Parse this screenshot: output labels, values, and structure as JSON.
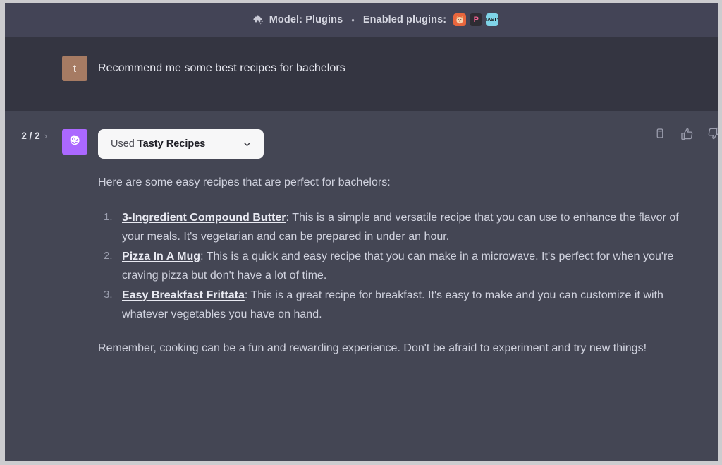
{
  "topbar": {
    "plugins_icon": "puzzle-piece-icon",
    "model_label": "Model: Plugins",
    "separator": "•",
    "enabled_label": "Enabled plugins:",
    "plugins": [
      {
        "name": "speak-plugin-badge",
        "short": ""
      },
      {
        "name": "prompt-perfect-plugin-badge",
        "short": "P"
      },
      {
        "name": "tasty-recipes-plugin-badge",
        "short": "TASTY"
      }
    ]
  },
  "user_message": {
    "avatar_initial": "t",
    "text": "Recommend me some best recipes for bachelors"
  },
  "assistant_message": {
    "pager": {
      "count": "2 / 2",
      "next_chevron": "›"
    },
    "avatar_icon": "openai-logo-icon",
    "plugin_pill": {
      "prefix": "Used",
      "plugin_name": "Tasty Recipes",
      "chevron_icon": "chevron-down-icon"
    },
    "intro": "Here are some easy recipes that are perfect for bachelors:",
    "recipes": [
      {
        "title": "3-Ingredient Compound Butter",
        "description": ": This is a simple and versatile recipe that you can use to enhance the flavor of your meals. It's vegetarian and can be prepared in under an hour."
      },
      {
        "title": "Pizza In A Mug",
        "description": ": This is a quick and easy recipe that you can make in a microwave. It's perfect for when you're craving pizza but don't have a lot of time."
      },
      {
        "title": "Easy Breakfast Frittata",
        "description": ": This is a great recipe for breakfast. It's easy to make and you can customize it with whatever vegetables you have on hand."
      }
    ],
    "outro": "Remember, cooking can be a fun and rewarding experience. Don't be afraid to experiment and try new things!",
    "actions": [
      {
        "name": "copy-icon"
      },
      {
        "name": "thumbs-up-icon"
      },
      {
        "name": "thumbs-down-icon"
      }
    ]
  },
  "colors": {
    "page_background": "#343541",
    "assistant_background": "#444654",
    "topbar_background": "#434456",
    "user_avatar": "#a67b63",
    "assistant_avatar": "#ab68ff",
    "pill_background": "#f7f7f8",
    "body_text": "#d0d2de",
    "window_border": "#cccccf"
  }
}
